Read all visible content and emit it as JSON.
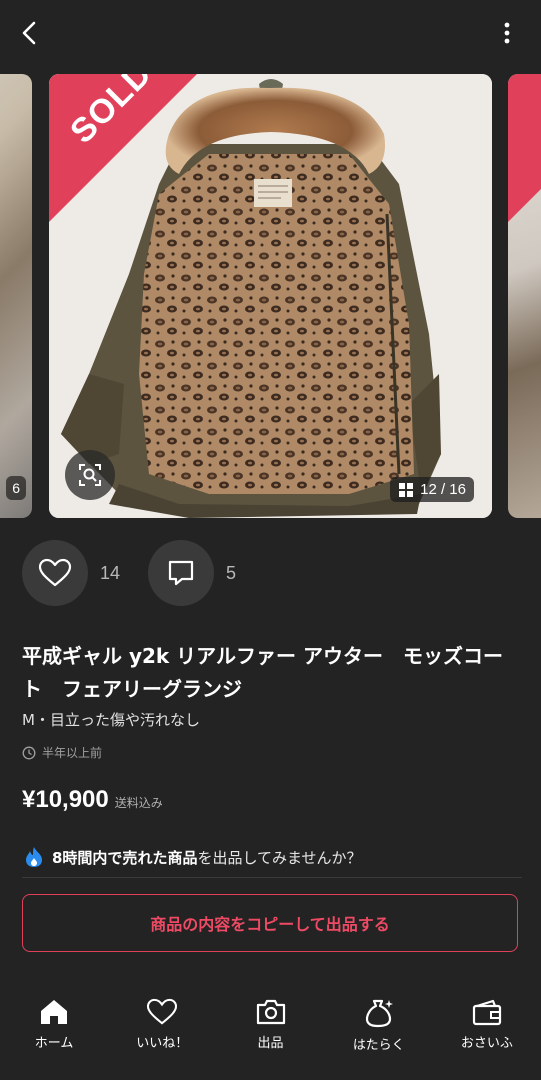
{
  "header": {
    "back_icon": "chevron-left-icon",
    "more_icon": "more-vertical-icon"
  },
  "carousel": {
    "sold_label": "SOLD",
    "prev_counter_fragment": "6",
    "counter": "12 / 16",
    "zoom_icon": "zoom-icon",
    "grid_icon": "grid-icon"
  },
  "stats": {
    "likes": "14",
    "comments": "5"
  },
  "item": {
    "title": "平成ギャル y2k リアルファー アウター　モッズコート　フェアリーグランジ",
    "condition": "M・目立った傷や汚れなし",
    "posted": "半年以上前",
    "price": "¥10,900",
    "shipping": "送料込み"
  },
  "promo": {
    "bold": "8時間内で売れた商品",
    "rest": "を出品してみませんか？"
  },
  "copy_button": "商品の内容をコピーして出品する",
  "nav": [
    {
      "label": "ホーム",
      "icon": "home-icon"
    },
    {
      "label": "いいね！",
      "icon": "heart-icon"
    },
    {
      "label": "出品",
      "icon": "camera-icon"
    },
    {
      "label": "はたらく",
      "icon": "money-bag-icon"
    },
    {
      "label": "おさいふ",
      "icon": "wallet-icon"
    }
  ],
  "colors": {
    "accent": "#e0405a",
    "background": "#232323"
  }
}
